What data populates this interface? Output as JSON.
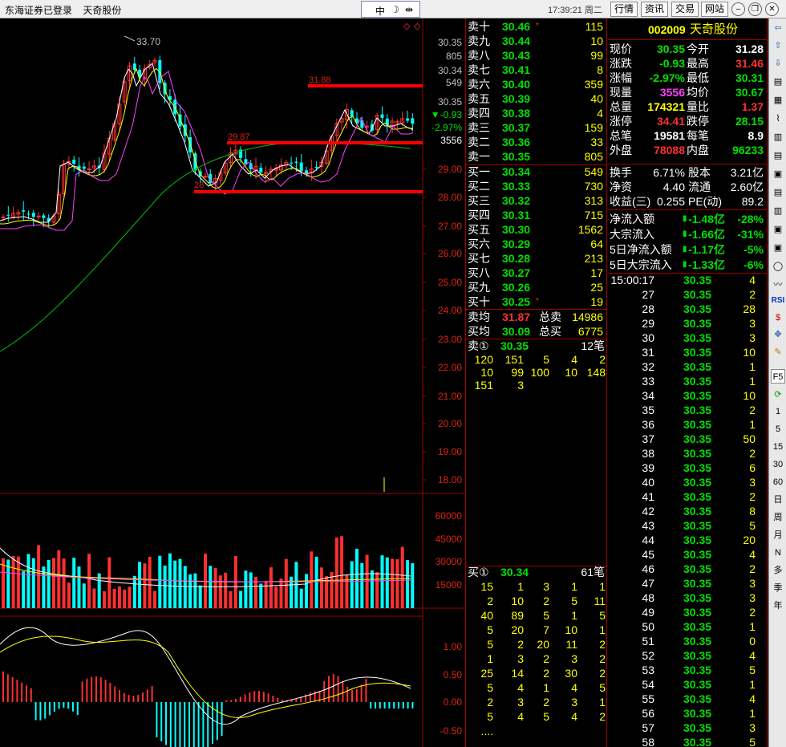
{
  "titlebar": {
    "broker": "东海证券已登录",
    "stock_name": "天奇股份",
    "tool_zhong": "中",
    "tool_moon": "☽",
    "tool_split": "⇹",
    "clock": "17:39:21 周二",
    "menus": [
      "行情",
      "资讯",
      "交易",
      "网站"
    ]
  },
  "chart": {
    "price_axis": [
      "30.35",
      "805",
      "30.34",
      "549",
      "30.35",
      "▼-0.93",
      "-2.97%",
      "3556",
      "29.00",
      "28.00",
      "27.00",
      "26.00",
      "25.00",
      "24.00",
      "23.00",
      "22.00",
      "21.00",
      "20.00",
      "19.00",
      "18.00"
    ],
    "volume_axis": [
      "60000",
      "45000",
      "30000",
      "15000"
    ],
    "macd_axis": [
      "1.00",
      "0.50",
      "0.00",
      "-0.50"
    ],
    "annotations": [
      "33.70",
      "31.88",
      "29.87",
      "28"
    ]
  },
  "quote": {
    "sells": [
      {
        "label": "卖十",
        "price": "30.46",
        "mark": "*",
        "vol": "115"
      },
      {
        "label": "卖九",
        "price": "30.44",
        "mark": "",
        "vol": "10"
      },
      {
        "label": "卖八",
        "price": "30.43",
        "mark": "",
        "vol": "99"
      },
      {
        "label": "卖七",
        "price": "30.41",
        "mark": "",
        "vol": "8"
      },
      {
        "label": "卖六",
        "price": "30.40",
        "mark": "",
        "vol": "359"
      },
      {
        "label": "卖五",
        "price": "30.39",
        "mark": "",
        "vol": "40"
      },
      {
        "label": "卖四",
        "price": "30.38",
        "mark": "",
        "vol": "4"
      },
      {
        "label": "卖三",
        "price": "30.37",
        "mark": "",
        "vol": "159"
      },
      {
        "label": "卖二",
        "price": "30.36",
        "mark": "",
        "vol": "33"
      },
      {
        "label": "卖一",
        "price": "30.35",
        "mark": "",
        "vol": "805"
      }
    ],
    "buys": [
      {
        "label": "买一",
        "price": "30.34",
        "mark": "",
        "vol": "549"
      },
      {
        "label": "买二",
        "price": "30.33",
        "mark": "",
        "vol": "730"
      },
      {
        "label": "买三",
        "price": "30.32",
        "mark": "",
        "vol": "313"
      },
      {
        "label": "买四",
        "price": "30.31",
        "mark": "",
        "vol": "715"
      },
      {
        "label": "买五",
        "price": "30.30",
        "mark": "",
        "vol": "1562"
      },
      {
        "label": "买六",
        "price": "30.29",
        "mark": "",
        "vol": "64"
      },
      {
        "label": "买七",
        "price": "30.28",
        "mark": "",
        "vol": "213"
      },
      {
        "label": "买八",
        "price": "30.27",
        "mark": "",
        "vol": "17"
      },
      {
        "label": "买九",
        "price": "30.26",
        "mark": "",
        "vol": "25"
      },
      {
        "label": "买十",
        "price": "30.25",
        "mark": "*",
        "vol": "19"
      }
    ],
    "avg_sell": {
      "label": "卖均",
      "price": "31.87",
      "total_label": "总卖",
      "total": "14986"
    },
    "avg_buy": {
      "label": "买均",
      "price": "30.09",
      "total_label": "总买",
      "total": "6775"
    },
    "sell1_queue": {
      "label": "卖①",
      "price": "30.35",
      "count": "12笔",
      "rows": [
        [
          "120",
          "151",
          "5",
          "4",
          "2"
        ],
        [
          "10",
          "99",
          "100",
          "10",
          "148"
        ],
        [
          "151",
          "3",
          "",
          "",
          ""
        ]
      ]
    },
    "buy1_queue": {
      "label": "买①",
      "price": "30.34",
      "count": "61笔",
      "rows": [
        [
          "15",
          "1",
          "3",
          "1",
          "1"
        ],
        [
          "2",
          "10",
          "2",
          "5",
          "11"
        ],
        [
          "40",
          "89",
          "5",
          "1",
          "5"
        ],
        [
          "5",
          "20",
          "7",
          "10",
          "1"
        ],
        [
          "5",
          "2",
          "20",
          "11",
          "2"
        ],
        [
          "1",
          "3",
          "2",
          "3",
          "2"
        ],
        [
          "25",
          "14",
          "2",
          "30",
          "2"
        ],
        [
          "5",
          "4",
          "1",
          "4",
          "5"
        ],
        [
          "2",
          "3",
          "2",
          "3",
          "1"
        ],
        [
          "5",
          "4",
          "5",
          "4",
          "2"
        ],
        [
          "....",
          "",
          "",
          "",
          ""
        ]
      ]
    }
  },
  "info": {
    "code": "002009",
    "name": "天奇股份",
    "rows": [
      {
        "l1": "现价",
        "v1": "30.35",
        "c1": "grn",
        "l2": "今开",
        "v2": "31.28",
        "c2": "wht"
      },
      {
        "l1": "涨跌",
        "v1": "-0.93",
        "c1": "grn",
        "l2": "最高",
        "v2": "31.46",
        "c2": "red"
      },
      {
        "l1": "涨幅",
        "v1": "-2.97%",
        "c1": "grn",
        "l2": "最低",
        "v2": "30.31",
        "c2": "grn"
      },
      {
        "l1": "现量",
        "v1": "3556",
        "c1": "mag",
        "l2": "均价",
        "v2": "30.67",
        "c2": "grn"
      },
      {
        "l1": "总量",
        "v1": "174321",
        "c1": "yel",
        "l2": "量比",
        "v2": "1.37",
        "c2": "red"
      },
      {
        "l1": "涨停",
        "v1": "34.41",
        "c1": "red",
        "l2": "跌停",
        "v2": "28.15",
        "c2": "grn"
      },
      {
        "l1": "总笔",
        "v1": "19581",
        "c1": "wht",
        "l2": "每笔",
        "v2": "8.9",
        "c2": "wht"
      },
      {
        "l1": "外盘",
        "v1": "78088",
        "c1": "red",
        "l2": "内盘",
        "v2": "96233",
        "c2": "grn"
      }
    ],
    "rows2": [
      {
        "l1": "换手",
        "v1": "6.71%",
        "l2": "股本",
        "v2": "3.21亿"
      },
      {
        "l1": "净资",
        "v1": "4.40",
        "l2": "流通",
        "v2": "2.60亿"
      },
      {
        "l1": "收益(三)",
        "v1": "0.255",
        "l2": "PE(动)",
        "v2": "89.2"
      }
    ],
    "flows": [
      {
        "label": "净流入额",
        "value": "-1.48亿",
        "pct": "-28%"
      },
      {
        "label": "大宗流入",
        "value": "-1.66亿",
        "pct": "-31%"
      },
      {
        "label": "5日净流入额",
        "value": "-1.17亿",
        "pct": "-5%"
      },
      {
        "label": "5日大宗流入",
        "value": "-1.33亿",
        "pct": "-6%"
      }
    ],
    "ticks": [
      {
        "t": "15:00:17",
        "p": "30.35",
        "v": "4"
      },
      {
        "t": "27",
        "p": "30.35",
        "v": "2"
      },
      {
        "t": "28",
        "p": "30.35",
        "v": "28"
      },
      {
        "t": "29",
        "p": "30.35",
        "v": "3"
      },
      {
        "t": "30",
        "p": "30.35",
        "v": "3"
      },
      {
        "t": "31",
        "p": "30.35",
        "v": "10"
      },
      {
        "t": "32",
        "p": "30.35",
        "v": "1"
      },
      {
        "t": "33",
        "p": "30.35",
        "v": "1"
      },
      {
        "t": "34",
        "p": "30.35",
        "v": "10"
      },
      {
        "t": "35",
        "p": "30.35",
        "v": "2"
      },
      {
        "t": "36",
        "p": "30.35",
        "v": "1"
      },
      {
        "t": "37",
        "p": "30.35",
        "v": "50"
      },
      {
        "t": "38",
        "p": "30.35",
        "v": "2"
      },
      {
        "t": "39",
        "p": "30.35",
        "v": "6"
      },
      {
        "t": "40",
        "p": "30.35",
        "v": "3"
      },
      {
        "t": "41",
        "p": "30.35",
        "v": "2"
      },
      {
        "t": "42",
        "p": "30.35",
        "v": "8"
      },
      {
        "t": "43",
        "p": "30.35",
        "v": "5"
      },
      {
        "t": "44",
        "p": "30.35",
        "v": "20"
      },
      {
        "t": "45",
        "p": "30.35",
        "v": "4"
      },
      {
        "t": "46",
        "p": "30.35",
        "v": "2"
      },
      {
        "t": "47",
        "p": "30.35",
        "v": "3"
      },
      {
        "t": "48",
        "p": "30.35",
        "v": "3"
      },
      {
        "t": "49",
        "p": "30.35",
        "v": "2"
      },
      {
        "t": "50",
        "p": "30.35",
        "v": "1"
      },
      {
        "t": "51",
        "p": "30.35",
        "v": "0"
      },
      {
        "t": "52",
        "p": "30.35",
        "v": "4"
      },
      {
        "t": "53",
        "p": "30.35",
        "v": "5"
      },
      {
        "t": "54",
        "p": "30.35",
        "v": "1"
      },
      {
        "t": "55",
        "p": "30.35",
        "v": "4"
      },
      {
        "t": "56",
        "p": "30.35",
        "v": "1"
      },
      {
        "t": "57",
        "p": "30.35",
        "v": "3"
      },
      {
        "t": "58",
        "p": "30.35",
        "v": "5"
      }
    ]
  },
  "sidebar": {
    "labels": [
      "RSI",
      "F5",
      "1",
      "5",
      "15",
      "30",
      "60",
      "日",
      "周",
      "月",
      "N",
      "多",
      "季",
      "年"
    ]
  }
}
